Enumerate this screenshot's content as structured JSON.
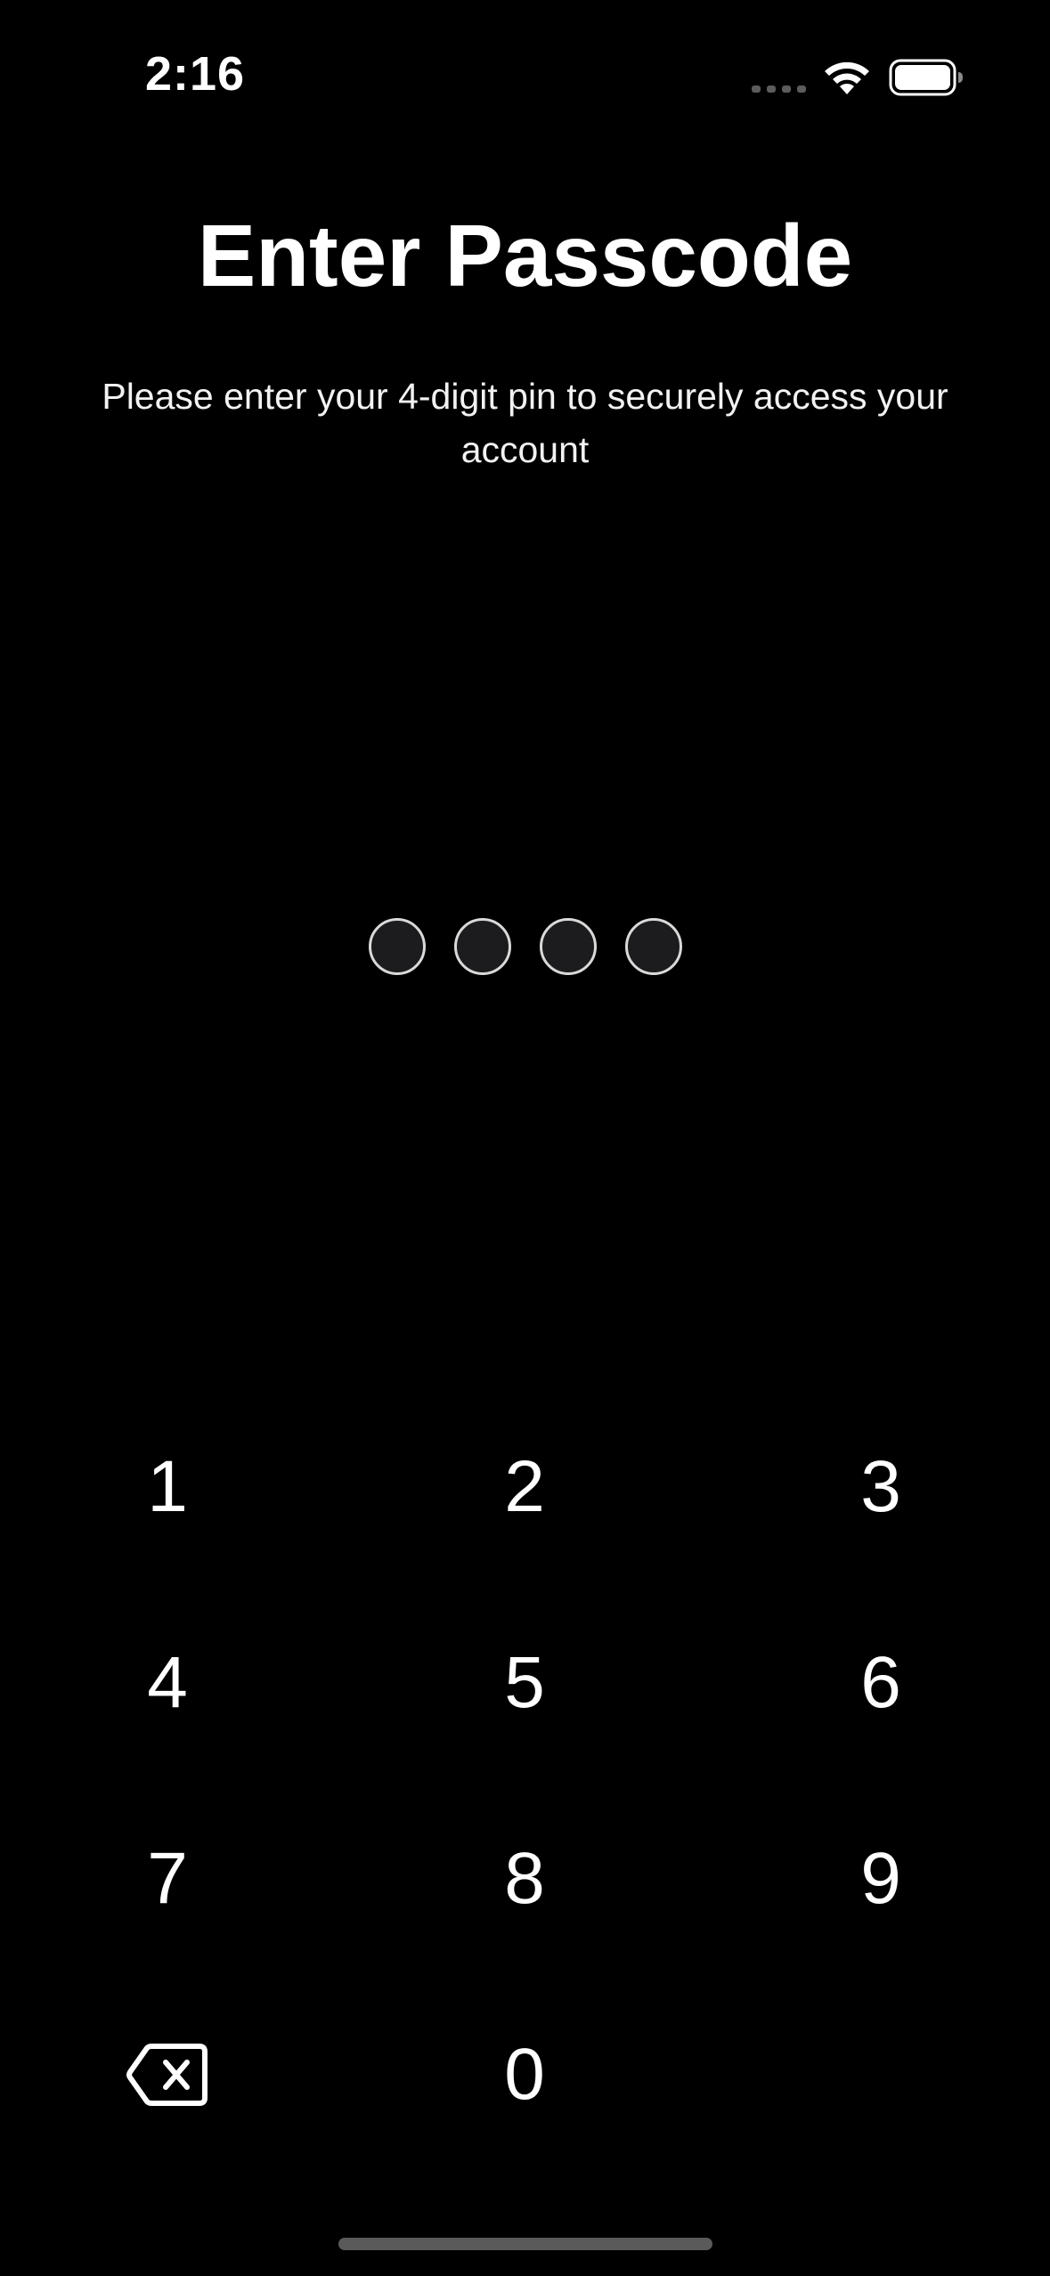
{
  "status_bar": {
    "time": "2:16",
    "signal_icon": "cellular-signal-icon",
    "wifi_icon": "wifi-icon",
    "battery_icon": "battery-icon"
  },
  "header": {
    "title": "Enter Passcode",
    "subtitle": "Please enter your 4-digit pin to securely access your account"
  },
  "pin": {
    "length": 4,
    "entered": 0
  },
  "keypad": {
    "keys": [
      "1",
      "2",
      "3",
      "4",
      "5",
      "6",
      "7",
      "8",
      "9",
      "0"
    ],
    "delete_icon": "backspace-icon"
  },
  "colors": {
    "background": "#000000",
    "text": "#ffffff",
    "dot_border": "#d9d9d9",
    "dot_fill": "#1c1c1e"
  }
}
